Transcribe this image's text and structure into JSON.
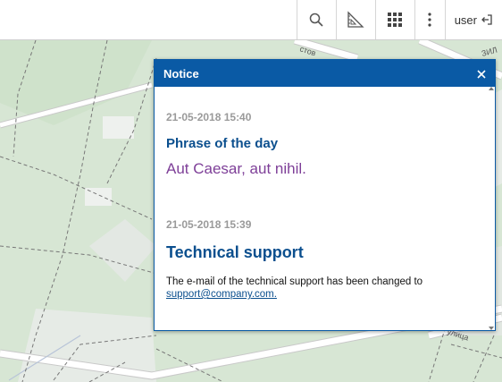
{
  "toolbar": {
    "buttons": [
      {
        "icon": "search-icon"
      },
      {
        "icon": "measure-icon"
      },
      {
        "icon": "grid-apps-icon"
      },
      {
        "icon": "more-vertical-icon"
      }
    ],
    "user_label": "user",
    "user_icon": "logout-icon"
  },
  "map": {
    "labels": {
      "top_street": "стов",
      "bottom_street": "улица",
      "top_right_fragment": "ЗИЛ"
    },
    "colors": {
      "park": "#d7e6d4",
      "block": "#e8ece8",
      "road": "#ffffff",
      "road_edge": "#c9c9c9",
      "path": "#777777"
    }
  },
  "dialog": {
    "title": "Notice",
    "close_icon": "close-icon",
    "messages": [
      {
        "date": "21-05-2018 15:40",
        "title": "Phrase of the day",
        "text": "Aut Caesar, aut nihil."
      },
      {
        "date": "21-05-2018 15:39",
        "title": "Technical support",
        "text": "The e-mail of the technical support has been changed to",
        "link": "support@company.com."
      }
    ]
  },
  "colors": {
    "header": "#0a5aa5",
    "title": "#0b4f8e",
    "phrase": "#7e3f98",
    "date": "#9a9a9a"
  }
}
